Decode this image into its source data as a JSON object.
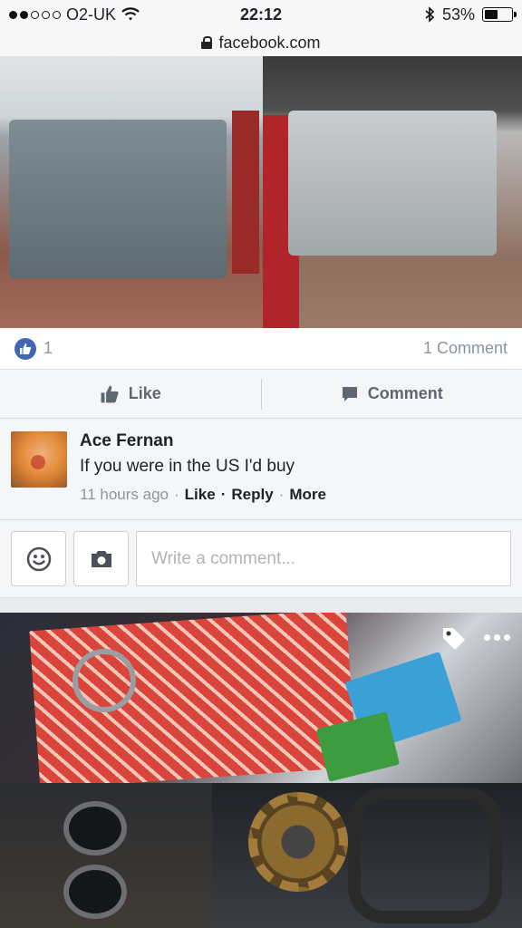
{
  "status_bar": {
    "carrier": "O2-UK",
    "time": "22:12",
    "battery_percent_label": "53%",
    "battery_level": 0.53,
    "signal_bars_filled": 2,
    "signal_bars_total": 5
  },
  "browser": {
    "url": "facebook.com"
  },
  "post": {
    "reaction_count": "1",
    "comment_count_label": "1 Comment",
    "like_label": "Like",
    "comment_label": "Comment"
  },
  "comment": {
    "author": "Ace Fernan",
    "text": "If you were in the US I'd buy",
    "timestamp": "11 hours ago",
    "like_link": "Like",
    "reply_link": "Reply",
    "more_link": "More"
  },
  "composer": {
    "placeholder": "Write a comment..."
  },
  "colors": {
    "accent": "#4267b2",
    "muted_text": "#90949c"
  },
  "icons": {
    "wifi": "wifi-icon",
    "bluetooth": "bluetooth-icon",
    "lock": "lock-icon",
    "like_reaction": "thumbs-up-icon",
    "like_action": "thumbs-up-icon",
    "comment_action": "speech-bubble-icon",
    "emoji": "smiley-icon",
    "camera": "camera-icon",
    "tag": "tag-icon",
    "more": "more-dots-icon"
  }
}
